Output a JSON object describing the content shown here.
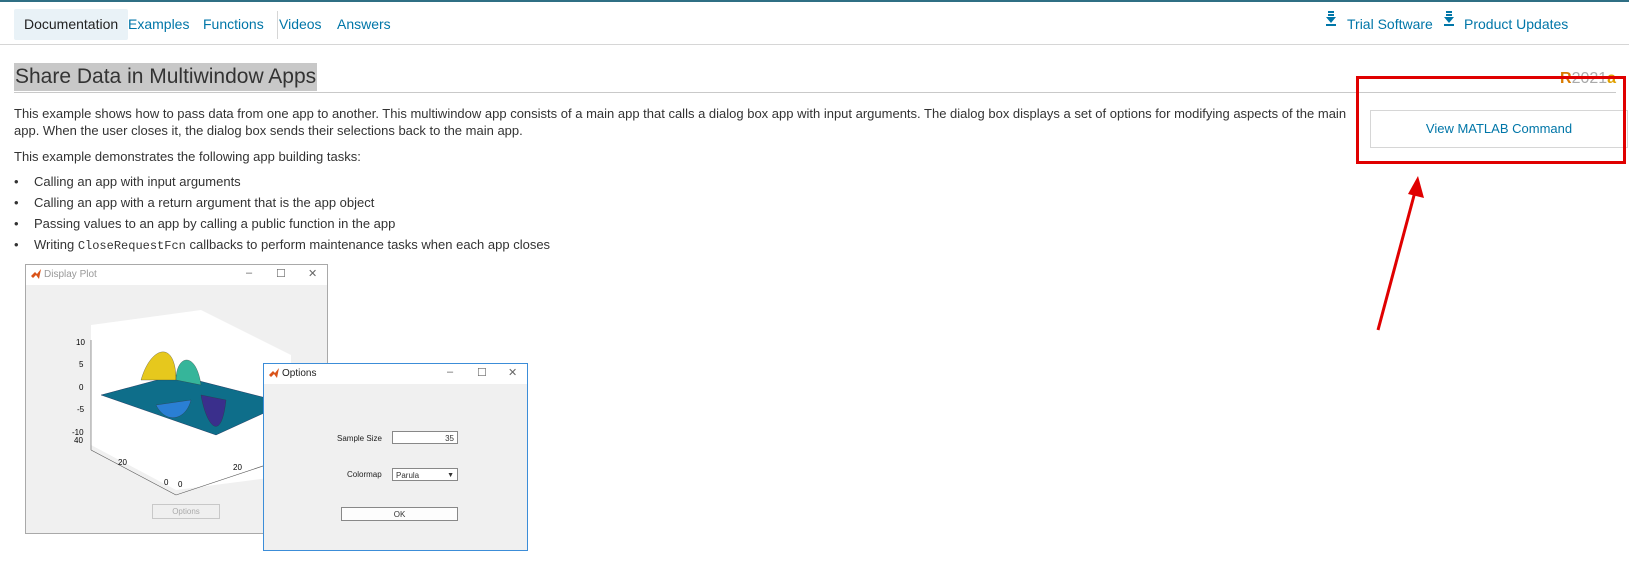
{
  "nav": {
    "tabs": [
      {
        "label": "Documentation"
      },
      {
        "label": "Examples"
      },
      {
        "label": "Functions"
      },
      {
        "label": "Videos"
      },
      {
        "label": "Answers"
      }
    ],
    "trial_label": "Trial Software",
    "updates_label": "Product Updates"
  },
  "page": {
    "title": "Share Data in Multiwindow Apps",
    "release_r": "R",
    "release_year": "2021",
    "release_a": "a",
    "intro_line1": "This example shows how to pass data from one app to another. This multiwindow app consists of a main app that calls a dialog box app with input arguments. The dialog box displays a set of options for modifying aspects of the main",
    "intro_line2": "app. When the user closes it, the dialog box sends their selections back to the main app.",
    "tasks_intro": "This example demonstrates the following app building tasks:",
    "bullets": [
      {
        "text": "Calling an app with input arguments"
      },
      {
        "text": "Calling an app with a return argument that is the app object"
      },
      {
        "text": "Passing values to an app by calling a public function in the app"
      },
      {
        "pre": "Writing ",
        "code": "CloseRequestFcn",
        "post": " callbacks to perform maintenance tasks when each app closes"
      }
    ],
    "bullet_symbol": "•",
    "view_command_label": "View MATLAB Command"
  },
  "figure": {
    "plot_window": {
      "title": "Display Plot",
      "options_button": "Options",
      "z_ticks": [
        "10",
        "5",
        "0",
        "-5",
        "-10"
      ],
      "x_ticks": [
        "40",
        "20",
        "0"
      ],
      "y_ticks": [
        "0",
        "20"
      ]
    },
    "options_window": {
      "title": "Options",
      "sample_size_label": "Sample Size",
      "sample_size_value": "35",
      "colormap_label": "Colormap",
      "colormap_value": "Parula",
      "ok_label": "OK"
    },
    "window_controls": {
      "minimize": "–",
      "maximize": "☐",
      "close": "✕"
    }
  },
  "colors": {
    "link": "#0076a8",
    "annotation": "#e00000",
    "title_highlight": "#c8c8c8"
  }
}
